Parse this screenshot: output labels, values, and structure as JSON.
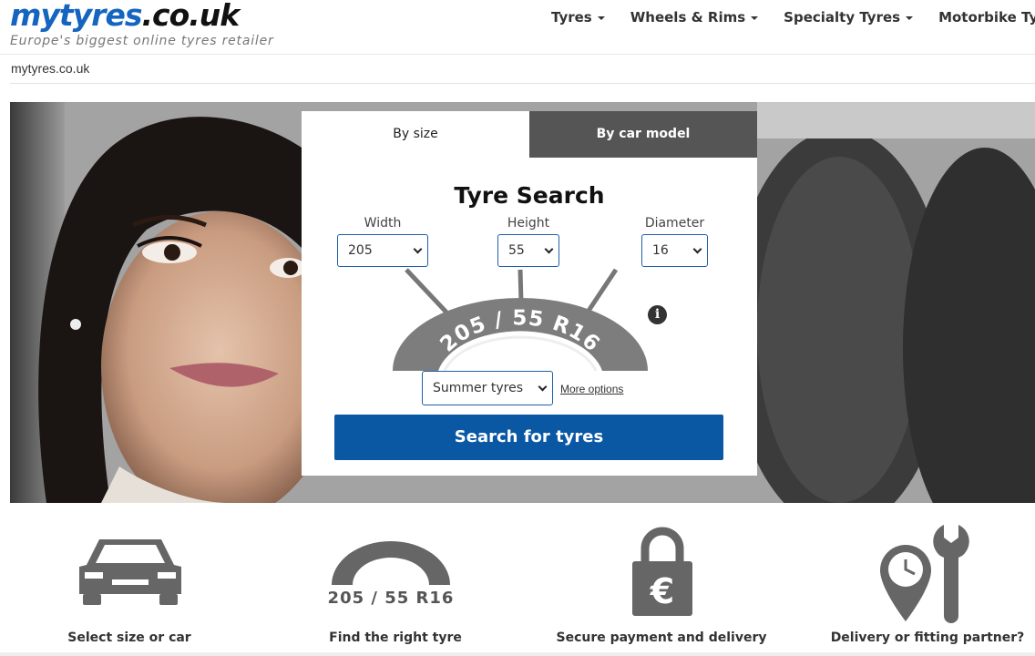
{
  "header": {
    "logo_main": "mytyres",
    "logo_suffix": ".co.uk",
    "tagline": "Europe's biggest online tyres retailer",
    "nav": [
      {
        "label": "Tyres"
      },
      {
        "label": "Wheels & Rims"
      },
      {
        "label": "Specialty Tyres"
      },
      {
        "label": "Motorbike Tyres"
      }
    ]
  },
  "breadcrumb": "mytyres.co.uk",
  "search": {
    "tabs": [
      {
        "label": "By size",
        "active": true
      },
      {
        "label": "By car model",
        "active": false
      }
    ],
    "title": "Tyre Search",
    "width_label": "Width",
    "width_value": "205",
    "height_label": "Height",
    "height_value": "55",
    "diameter_label": "Diameter",
    "diameter_value": "16",
    "tyre_marking": "205 / 55 R16",
    "season_value": "Summer tyres",
    "more_options": "More options",
    "info_icon": "info-icon",
    "submit_label": "Search for tyres"
  },
  "features": [
    {
      "label": "Select size or car",
      "icon": "car-icon"
    },
    {
      "label": "Find the right tyre",
      "icon": "tyre-icon",
      "marking": "205 / 55 R16"
    },
    {
      "label": "Secure payment and delivery",
      "icon": "padlock-euro-icon",
      "symbol": "€"
    },
    {
      "label": "Delivery or fitting partner?",
      "icon": "location-wrench-icon"
    }
  ],
  "colors": {
    "brand_blue": "#1565c0",
    "button_blue": "#0a57a4",
    "tab_inactive": "#555555",
    "icon_grey": "#666666"
  }
}
